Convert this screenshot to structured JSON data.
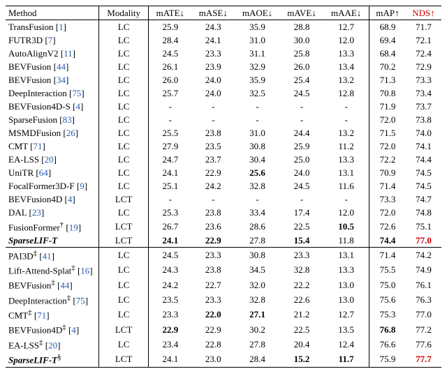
{
  "chart_data": {
    "type": "table",
    "title": "",
    "headers": [
      "Method",
      "Modality",
      "mATE↓",
      "mASE↓",
      "mAOE↓",
      "mAVE↓",
      "mAAE↓",
      "mAP↑",
      "NDS↑"
    ],
    "header_styles": [
      "",
      "",
      "",
      "",
      "",
      "",
      "",
      "",
      "red"
    ],
    "sections": [
      [
        {
          "method": "TransFusion",
          "ref": "1",
          "modality": "LC",
          "mate": "25.9",
          "mase": "24.3",
          "maoe": "35.9",
          "mave": "28.8",
          "maae": "12.7",
          "map": "68.9",
          "nds": "71.7"
        },
        {
          "method": "FUTR3D",
          "ref": "7",
          "modality": "LC",
          "mate": "28.4",
          "mase": "24.1",
          "maoe": "31.0",
          "mave": "30.0",
          "maae": "12.0",
          "map": "69.4",
          "nds": "72.1"
        },
        {
          "method": "AutoAlignV2",
          "ref": "11",
          "modality": "LC",
          "mate": "24.5",
          "mase": "23.3",
          "maoe": "31.1",
          "mave": "25.8",
          "maae": "13.3",
          "map": "68.4",
          "nds": "72.4"
        },
        {
          "method": "BEVFusion",
          "ref": "44",
          "modality": "LC",
          "mate": "26.1",
          "mase": "23.9",
          "maoe": "32.9",
          "mave": "26.0",
          "maae": "13.4",
          "map": "70.2",
          "nds": "72.9"
        },
        {
          "method": "BEVFusion",
          "ref": "34",
          "modality": "LC",
          "mate": "26.0",
          "mase": "24.0",
          "maoe": "35.9",
          "mave": "25.4",
          "maae": "13.2",
          "map": "71.3",
          "nds": "73.3"
        },
        {
          "method": "DeepInteraction",
          "ref": "75",
          "modality": "LC",
          "mate": "25.7",
          "mase": "24.0",
          "maoe": "32.5",
          "mave": "24.5",
          "maae": "12.8",
          "map": "70.8",
          "nds": "73.4"
        },
        {
          "method": "BEVFusion4D-S",
          "ref": "4",
          "modality": "LC",
          "mate": "-",
          "mase": "-",
          "maoe": "-",
          "mave": "-",
          "maae": "-",
          "map": "71.9",
          "nds": "73.7"
        },
        {
          "method": "SparseFusion",
          "ref": "83",
          "modality": "LC",
          "mate": "-",
          "mase": "-",
          "maoe": "-",
          "mave": "-",
          "maae": "-",
          "map": "72.0",
          "nds": "73.8"
        },
        {
          "method": "MSMDFusion",
          "ref": "26",
          "modality": "LC",
          "mate": "25.5",
          "mase": "23.8",
          "maoe": "31.0",
          "mave": "24.4",
          "maae": "13.2",
          "map": "71.5",
          "nds": "74.0"
        },
        {
          "method": "CMT",
          "ref": "71",
          "modality": "LC",
          "mate": "27.9",
          "mase": "23.5",
          "maoe": "30.8",
          "mave": "25.9",
          "maae": "11.2",
          "map": "72.0",
          "nds": "74.1"
        },
        {
          "method": "EA-LSS",
          "ref": "20",
          "modality": "LC",
          "mate": "24.7",
          "mase": "23.7",
          "maoe": "30.4",
          "mave": "25.0",
          "maae": "13.3",
          "map": "72.2",
          "nds": "74.4"
        },
        {
          "method": "UniTR",
          "ref": "64",
          "modality": "LC",
          "mate": "24.1",
          "mase": "22.9",
          "maoe": "25.6",
          "maoe_bold": true,
          "mave": "24.0",
          "maae": "13.1",
          "map": "70.9",
          "nds": "74.5"
        },
        {
          "method": "FocalFormer3D-F",
          "ref": "9",
          "modality": "LC",
          "mate": "25.1",
          "mase": "24.2",
          "maoe": "32.8",
          "mave": "24.5",
          "maae": "11.6",
          "map": "71.4",
          "nds": "74.5"
        },
        {
          "method": "BEVFusion4D",
          "ref": "4",
          "modality": "LCT",
          "mate": "-",
          "mase": "-",
          "maoe": "-",
          "mave": "-",
          "maae": "-",
          "map": "73.3",
          "nds": "74.7"
        },
        {
          "method": "DAL",
          "ref": "23",
          "modality": "LC",
          "mate": "25.3",
          "mase": "23.8",
          "maoe": "33.4",
          "mave": "17.4",
          "maae": "12.0",
          "map": "72.0",
          "nds": "74.8"
        },
        {
          "method": "FusionFormer",
          "sup": "†",
          "ref": "19",
          "modality": "LCT",
          "mate": "26.7",
          "mase": "23.6",
          "maoe": "28.6",
          "mave": "22.5",
          "maae": "10.5",
          "maae_bold": true,
          "map": "72.6",
          "nds": "75.1"
        },
        {
          "method": "SparseLIF-T",
          "method_bi": true,
          "modality": "LCT",
          "mate": "24.1",
          "mate_bold": true,
          "mase": "22.9",
          "mase_bold": true,
          "maoe": "27.8",
          "mave": "15.4",
          "mave_bold": true,
          "maae": "11.8",
          "map": "74.4",
          "map_bold": true,
          "nds": "77.0",
          "nds_bold": true,
          "nds_red": true
        }
      ],
      [
        {
          "method": "PAI3D",
          "sup": "‡",
          "ref": "41",
          "modality": "LC",
          "mate": "24.5",
          "mase": "23.3",
          "maoe": "30.8",
          "mave": "23.3",
          "maae": "13.1",
          "map": "71.4",
          "nds": "74.2"
        },
        {
          "method": "Lift-Attend-Splat",
          "sup": "‡",
          "ref": "16",
          "modality": "LC",
          "mate": "24.3",
          "mase": "23.8",
          "maoe": "34.5",
          "mave": "32.8",
          "maae": "13.3",
          "map": "75.5",
          "nds": "74.9"
        },
        {
          "method": "BEVFusion",
          "sup": "‡",
          "ref": "44",
          "modality": "LC",
          "mate": "24.2",
          "mase": "22.7",
          "maoe": "32.0",
          "mave": "22.2",
          "maae": "13.0",
          "map": "75.0",
          "nds": "76.1"
        },
        {
          "method": "DeepInteraction",
          "sup": "‡",
          "ref": "75",
          "modality": "LC",
          "mate": "23.5",
          "mase": "23.3",
          "maoe": "32.8",
          "mave": "22.6",
          "maae": "13.0",
          "map": "75.6",
          "nds": "76.3"
        },
        {
          "method": "CMT",
          "sup": "‡",
          "ref": "71",
          "modality": "LC",
          "mate": "23.3",
          "mase": "22.0",
          "mase_bold": true,
          "maoe": "27.1",
          "maoe_bold": true,
          "mave": "21.2",
          "maae": "12.7",
          "map": "75.3",
          "nds": "77.0"
        },
        {
          "method": "BEVFusion4D",
          "sup": "‡",
          "ref": "4",
          "modality": "LCT",
          "mate": "22.9",
          "mate_bold": true,
          "mase": "22.9",
          "maoe": "30.2",
          "mave": "22.5",
          "maae": "13.5",
          "map": "76.8",
          "map_bold": true,
          "nds": "77.2"
        },
        {
          "method": "EA-LSS",
          "sup": "‡",
          "ref": "20",
          "modality": "LC",
          "mate": "23.4",
          "mase": "22.8",
          "maoe": "27.8",
          "mave": "20.4",
          "maae": "12.4",
          "map": "76.6",
          "nds": "77.6"
        },
        {
          "method": "SparseLIF-T",
          "sup": "§",
          "method_bi": true,
          "modality": "LCT",
          "mate": "24.1",
          "mase": "23.0",
          "maoe": "28.4",
          "mave": "15.2",
          "mave_bold": true,
          "maae": "11.7",
          "maae_bold": true,
          "map": "75.9",
          "nds": "77.7",
          "nds_bold": true,
          "nds_red": true
        }
      ]
    ]
  }
}
